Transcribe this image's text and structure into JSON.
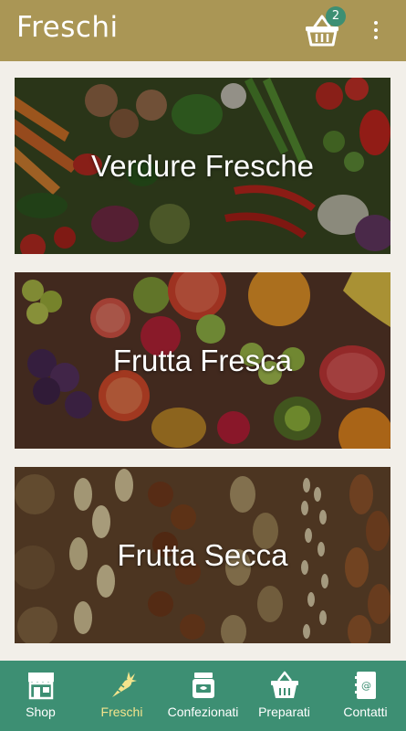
{
  "appbar": {
    "title": "Freschi",
    "cart_count": "2",
    "cart_icon": "basket-icon",
    "menu_icon": "more-vert-icon"
  },
  "categories": [
    {
      "label": "Verdure Fresche",
      "image": "vegetables"
    },
    {
      "label": "Frutta Fresca",
      "image": "fruits"
    },
    {
      "label": "Frutta Secca",
      "image": "nuts"
    }
  ],
  "bottom_nav": {
    "items": [
      {
        "label": "Shop",
        "icon": "store-icon",
        "active": false
      },
      {
        "label": "Freschi",
        "icon": "carrot-icon",
        "active": true
      },
      {
        "label": "Confezionati",
        "icon": "jar-icon",
        "active": false
      },
      {
        "label": "Preparati",
        "icon": "basket-icon",
        "active": false
      },
      {
        "label": "Contatti",
        "icon": "contact-book-icon",
        "active": false
      }
    ]
  },
  "colors": {
    "appbar": "#aa9655",
    "bottom_nav": "#3d8f73",
    "badge": "#3d8f73",
    "active_nav": "#f4e48c",
    "background": "#f2efe9"
  }
}
